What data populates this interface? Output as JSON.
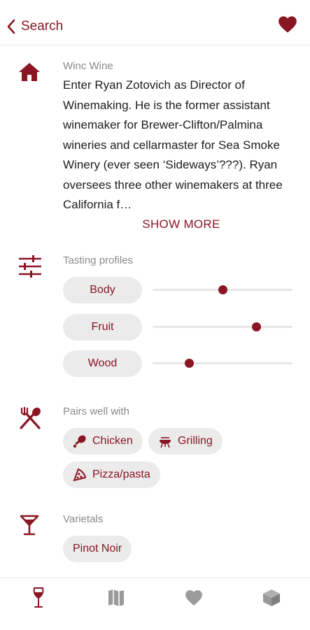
{
  "header": {
    "back_label": "Search",
    "back_icon": "chevron-left-icon",
    "favorite_icon": "heart-icon"
  },
  "colors": {
    "accent": "#8a1523",
    "pill_bg": "#ebebeb",
    "muted_text": "#8a8a8a"
  },
  "about": {
    "icon": "home-icon",
    "title": "Winc Wine",
    "description": "Enter Ryan Zotovich as Director of Winemaking. He is the former assistant winemaker for Brewer-Clifton/Palmina wineries and cellarmaster for Sea Smoke Winery (ever seen ‘Sideways’???). Ryan oversees three other winemakers at three California f…",
    "show_more": "SHOW MORE"
  },
  "tasting": {
    "icon": "sliders-icon",
    "title": "Tasting profiles",
    "profiles": [
      {
        "label": "Body",
        "value": 0.5
      },
      {
        "label": "Fruit",
        "value": 0.74
      },
      {
        "label": "Wood",
        "value": 0.26
      }
    ]
  },
  "pairs": {
    "icon": "fork-knife-icon",
    "title": "Pairs well with",
    "items": [
      {
        "label": "Chicken",
        "icon": "drumstick-icon"
      },
      {
        "label": "Grilling",
        "icon": "grill-icon"
      },
      {
        "label": "Pizza/pasta",
        "icon": "pizza-icon"
      }
    ]
  },
  "varietals": {
    "icon": "wine-glass-icon",
    "title": "Varietals",
    "items": [
      "Pinot Noir"
    ]
  },
  "bottom_nav": {
    "tabs": [
      {
        "icon": "wine-glass-icon",
        "active": true
      },
      {
        "icon": "map-icon",
        "active": false
      },
      {
        "icon": "heart-icon",
        "active": false
      },
      {
        "icon": "box-icon",
        "active": false
      }
    ]
  }
}
